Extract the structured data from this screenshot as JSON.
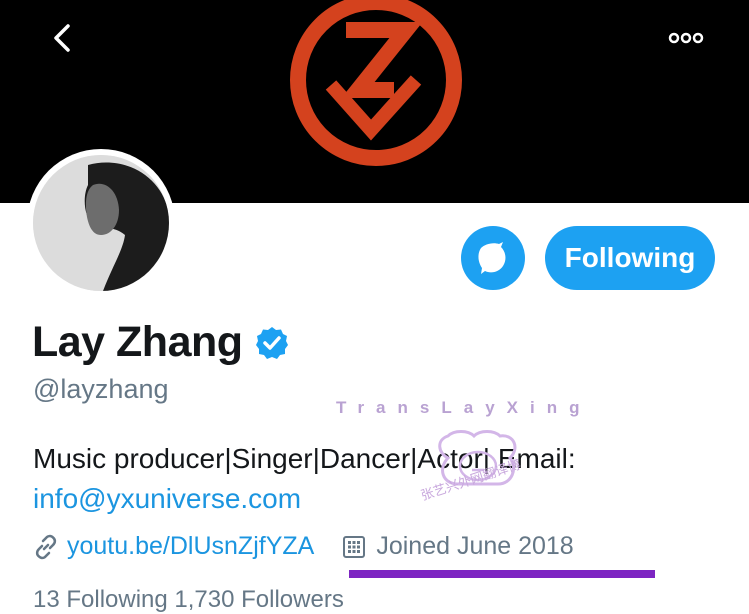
{
  "header": {
    "back_icon": "chevron-left-icon",
    "more_icon": "more-horizontal-icon",
    "banner_logo_color": "#d4421e"
  },
  "profile": {
    "display_name": "Lay Zhang",
    "verified_icon": "verified-badge-icon",
    "handle": "@layzhang",
    "bio_text": "Music producer|Singer|Dancer|Actor| Email:",
    "bio_email": "info@yxuniverse.com",
    "link_icon": "link-icon",
    "link_text": "youtu.be/DlUsnZjfYZA",
    "calendar_icon": "calendar-icon",
    "joined_text": "Joined June 2018"
  },
  "actions": {
    "icon_button_icon": "logo-icon",
    "following_label": "Following"
  },
  "watermark": {
    "text": "TransLayXing",
    "sub_text": "张艺兴外网翻译博"
  },
  "stats": {
    "partial_text": "13 Following   1,730 Followers"
  },
  "colors": {
    "accent": "#1da1f2",
    "link": "#1b95e0",
    "secondary_text": "#657786",
    "underline_mark": "#7d25c2"
  }
}
